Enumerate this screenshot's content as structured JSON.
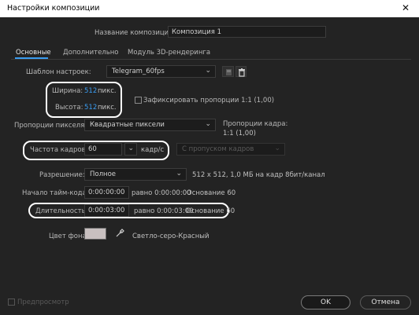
{
  "window": {
    "title": "Настройки композиции",
    "close_icon": "✕"
  },
  "name_field": {
    "label": "Название композиции:",
    "value": "Композиция 1"
  },
  "tabs": [
    {
      "label": "Основные",
      "active": true
    },
    {
      "label": "Дополнительно",
      "active": false
    },
    {
      "label": "Модуль 3D-рендеринга",
      "active": false
    }
  ],
  "preset": {
    "label": "Шаблон настроек:",
    "value": "Telegram_60fps"
  },
  "width": {
    "label": "Ширина:",
    "value": "512",
    "unit": "пикс."
  },
  "height": {
    "label": "Высота:",
    "value": "512",
    "unit": "пикс."
  },
  "lock_ratio": {
    "label": "Зафиксировать пропорции 1:1 (1,00)",
    "checked": false
  },
  "pixel_aspect": {
    "label": "Пропорции пикселя:",
    "value": "Квадратные пиксели"
  },
  "frame_aspect": {
    "label": "Пропорции кадра:",
    "value": "1:1 (1,00)"
  },
  "frame_rate": {
    "label": "Частота кадров:",
    "value": "60",
    "unit": "кадр/с",
    "drop_frame": "С пропуском кадров"
  },
  "resolution": {
    "label": "Разрешение:",
    "value": "Полное",
    "info": "512 x 512, 1,0 МБ на кадр 8бит/канал"
  },
  "start_timecode": {
    "label": "Начало тайм-кода:",
    "value": "0:00:00:00",
    "equals": "равно 0:00:00:00",
    "base": "Основание 60"
  },
  "duration": {
    "label": "Длительность:",
    "value": "0:00:03:00",
    "equals": "равно 0:00:03:00",
    "base": "Основание 60"
  },
  "background": {
    "label": "Цвет фона:",
    "color": "#c8c0c0",
    "name": "Светло-серо-Красный"
  },
  "preview": {
    "label": "Предпросмотр",
    "checked": false
  },
  "buttons": {
    "ok": "OK",
    "cancel": "Отмена"
  },
  "colors": {
    "accent": "#3a9cf0",
    "bg": "#232323",
    "annotation": "#ffffff"
  }
}
